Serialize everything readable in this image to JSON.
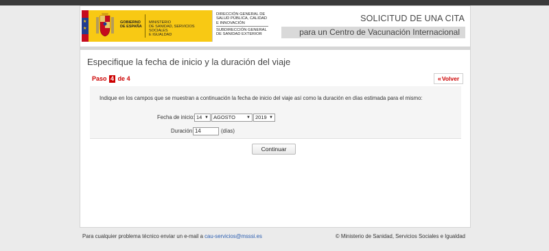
{
  "header": {
    "logo": {
      "gobierno_text": "GOBIERNO\nDE ESPAÑA",
      "ministerio_text": "MINISTERIO\nDE SANIDAD, SERVICIOS SOCIALES\nE IGUALDAD",
      "direccion_text": "DIRECCIÓN GENERAL DE SALUD PÚBLICA, CALIDAD E INNOVACIÓN",
      "subdireccion_text": "SUBDIRECCIÓN GENERAL DE SANIDAD EXTERIOR"
    },
    "title": "SOLICITUD DE UNA CITA",
    "subtitle": "para un Centro de Vacunación Internacional"
  },
  "main": {
    "page_title": "Especifique la fecha de inicio y la duración del viaje",
    "step": {
      "prefix": "Paso",
      "current": "4",
      "separator": "de",
      "total": "4"
    },
    "back_label": "Volver",
    "instructions": "Indique en los campos que se muestran a continuación la fecha de inicio del viaje así como la duración en días estimada para el mismo:",
    "start_date": {
      "label": "Fecha de inicio:",
      "day": "14",
      "month": "AGOSTO",
      "year": "2019"
    },
    "duration": {
      "label": "Duración:",
      "value": "14",
      "unit": "(días)"
    },
    "continue_label": "Continuar"
  },
  "footer": {
    "left_text": "Para cualquier problema técnico enviar un e-mail a ",
    "email": "cau-servicios@msssi.es",
    "right_text": "© Ministerio de Sanidad, Servicios Sociales e Igualdad"
  },
  "colors": {
    "accent_red": "#cc0000",
    "logo_yellow": "#f8c914",
    "link_blue": "#2a5db0"
  }
}
